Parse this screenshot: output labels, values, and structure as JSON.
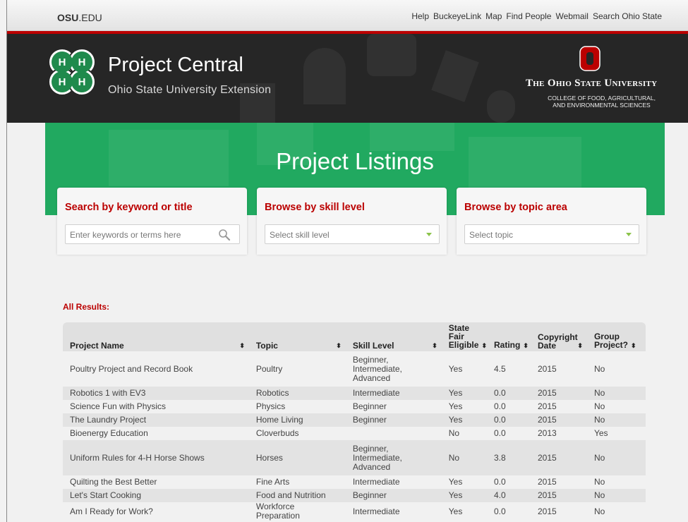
{
  "osu_bar": {
    "logo_bold": "OSU",
    "logo_rest": ".EDU",
    "links": [
      "Help",
      "BuckeyeLink",
      "Map",
      "Find People",
      "Webmail",
      "Search Ohio State"
    ]
  },
  "header": {
    "title": "Project Central",
    "subtitle": "Ohio State University Extension",
    "university": "The Ohio State University",
    "college_line1": "COLLEGE OF FOOD, AGRICULTURAL,",
    "college_line2": "AND ENVIRONMENTAL SCIENCES"
  },
  "hero": {
    "title": "Project Listings"
  },
  "search": {
    "keyword": {
      "title": "Search by keyword or title",
      "placeholder": "Enter keywords or terms here"
    },
    "skill": {
      "title": "Browse by skill level",
      "selected": "Select skill level"
    },
    "topic": {
      "title": "Browse by topic area",
      "selected": "Select topic"
    }
  },
  "results": {
    "label": "All Results:",
    "columns": [
      {
        "line1": "",
        "line2": "",
        "line3": "Project Name"
      },
      {
        "line1": "",
        "line2": "",
        "line3": "Topic"
      },
      {
        "line1": "",
        "line2": "",
        "line3": "Skill Level"
      },
      {
        "line1": "State",
        "line2": "Fair",
        "line3": "Eligible"
      },
      {
        "line1": "",
        "line2": "",
        "line3": "Rating"
      },
      {
        "line1": "",
        "line2": "Copyright",
        "line3": "Date"
      },
      {
        "line1": "",
        "line2": "Group",
        "line3": "Project?"
      }
    ],
    "sort_glyph": "⬍",
    "rows": [
      {
        "name": "Poultry Project and Record Book",
        "topic": "Poultry",
        "skill": "Beginner,\nIntermediate,\nAdvanced",
        "fair": "Yes",
        "rating": "4.5",
        "date": "2015",
        "group": "No"
      },
      {
        "name": "Robotics 1 with EV3",
        "topic": "Robotics",
        "skill": "Intermediate",
        "fair": "Yes",
        "rating": "0.0",
        "date": "2015",
        "group": "No"
      },
      {
        "name": "Science Fun with Physics",
        "topic": "Physics",
        "skill": "Beginner",
        "fair": "Yes",
        "rating": "0.0",
        "date": "2015",
        "group": "No"
      },
      {
        "name": "The Laundry Project",
        "topic": "Home Living",
        "skill": "Beginner",
        "fair": "Yes",
        "rating": "0.0",
        "date": "2015",
        "group": "No"
      },
      {
        "name": "Bioenergy Education",
        "topic": "Cloverbuds",
        "skill": "",
        "fair": "No",
        "rating": "0.0",
        "date": "2013",
        "group": "Yes"
      },
      {
        "name": "Uniform Rules for 4-H Horse Shows",
        "topic": "Horses",
        "skill": "Beginner,\nIntermediate,\nAdvanced",
        "fair": "No",
        "rating": "3.8",
        "date": "2015",
        "group": "No"
      },
      {
        "name": "Quilting the Best Better",
        "topic": "Fine Arts",
        "skill": "Intermediate",
        "fair": "Yes",
        "rating": "0.0",
        "date": "2015",
        "group": "No"
      },
      {
        "name": "Let's Start Cooking",
        "topic": "Food and Nutrition",
        "skill": "Beginner",
        "fair": "Yes",
        "rating": "4.0",
        "date": "2015",
        "group": "No"
      },
      {
        "name": "Am I Ready for Work?",
        "topic": "Workforce\nPreparation",
        "skill": "Intermediate",
        "fair": "Yes",
        "rating": "0.0",
        "date": "2015",
        "group": "No"
      }
    ]
  },
  "colors": {
    "osu_red": "#bb0000",
    "hero_green": "#21a960",
    "header_dark": "#262626"
  }
}
